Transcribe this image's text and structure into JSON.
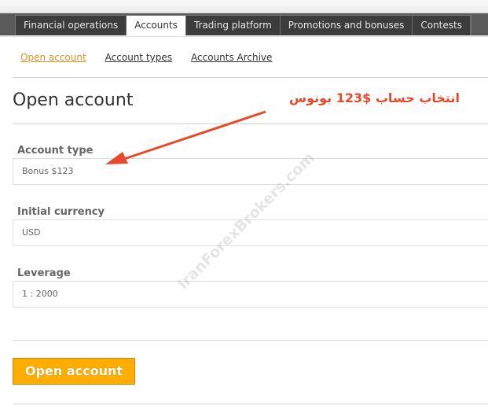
{
  "nav": {
    "tabs": [
      {
        "label": "Financial operations"
      },
      {
        "label": "Accounts",
        "active": true
      },
      {
        "label": "Trading platform"
      },
      {
        "label": "Promotions and bonuses"
      },
      {
        "label": "Contests"
      }
    ]
  },
  "subnav": {
    "items": [
      {
        "label": "Open account",
        "active": true
      },
      {
        "label": "Account types"
      },
      {
        "label": "Accounts Archive"
      }
    ]
  },
  "page_title": "Open account",
  "annotation": "انتخاب حساب $123 بونوس",
  "watermark": "IranForexBrokers.com",
  "form": {
    "account_type": {
      "label": "Account type",
      "value": "Bonus $123"
    },
    "currency": {
      "label": "Initial currency",
      "value": "USD"
    },
    "leverage": {
      "label": "Leverage",
      "value": "1 : 2000"
    }
  },
  "submit_label": "Open account",
  "colors": {
    "accent": "#ffad00",
    "annotation": "#e8492a",
    "link_active": "#e0901a"
  }
}
